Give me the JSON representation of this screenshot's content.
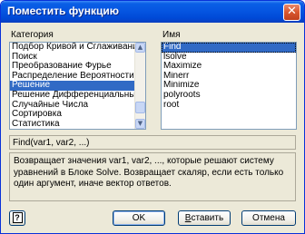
{
  "window": {
    "title": "Поместить функцию",
    "close_glyph": "✕"
  },
  "category": {
    "label": "Категория",
    "items": [
      "Подбор Кривой и Сглаживания",
      "Поиск",
      "Преобразование Фурье",
      "Распределение Вероятности",
      "Решение",
      "Решение Дифференциальных",
      "Случайные Числа",
      "Сортировка",
      "Статистика"
    ],
    "selected": "Решение"
  },
  "name": {
    "label": "Имя",
    "items": [
      "Find",
      "lsolve",
      "Maximize",
      "Minerr",
      "Minimize",
      "polyroots",
      "root"
    ],
    "selected": "Find"
  },
  "syntax": "Find(var1, var2, ...)",
  "description": "Возвращает значения var1, var2, ..., которые решают систему уравнений в Блоке Solve. Возвращает скаляр, если есть только один аргумент, иначе вектор ответов.",
  "buttons": {
    "help_glyph": "?",
    "ok": "OK",
    "insert_accel": "В",
    "insert_rest": "ставить",
    "cancel": "Отмена"
  },
  "icons": {
    "scroll_up": "▲",
    "scroll_down": "▼"
  }
}
